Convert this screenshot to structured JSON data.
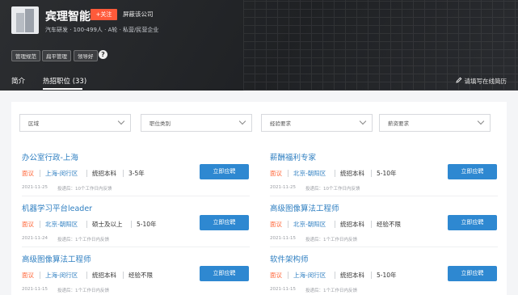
{
  "company": {
    "name": "宾理智能",
    "follow_label": "+关注",
    "blocked_label": "屏蔽该公司",
    "meta": "汽车研发 · 100-499人 · A轮 · 私营/民营企业",
    "tags": [
      "管理规范",
      "扁平管理",
      "领导好"
    ]
  },
  "tabs": [
    {
      "label": "简介"
    },
    {
      "label": "热招职位 (33)",
      "active": true
    }
  ],
  "resume_link": "请填写在线简历",
  "filters": [
    "区域",
    "职位类别",
    "经验要求",
    "薪资要求"
  ],
  "jobs": [
    {
      "title": "办公室行政-上海",
      "salary": "面议",
      "location": "上海-闵行区",
      "education": "统招本科",
      "experience": "3-5年",
      "date": "2021-11-25",
      "feedback": "投递后：10个工作日内反馈",
      "apply_label": "立即应聘"
    },
    {
      "title": "薪酬福利专家",
      "salary": "面议",
      "location": "北京-朝阳区",
      "education": "统招本科",
      "experience": "5-10年",
      "date": "2021-11-25",
      "feedback": "投递后：10个工作日内反馈",
      "apply_label": "立即应聘"
    },
    {
      "title": "机器学习平台leader",
      "salary": "面议",
      "location": "北京-朝阳区",
      "education": "硕士及以上",
      "experience": "5-10年",
      "date": "2021-11-24",
      "feedback": "投递后：1个工作日内反馈",
      "apply_label": "立即应聘"
    },
    {
      "title": "高级图像算法工程师",
      "salary": "面议",
      "location": "北京-朝阳区",
      "education": "统招本科",
      "experience": "经验不限",
      "date": "2021-11-15",
      "feedback": "投递后：1个工作日内反馈",
      "apply_label": "立即应聘"
    },
    {
      "title": "高级图像算法工程师",
      "salary": "面议",
      "location": "上海-闵行区",
      "education": "统招本科",
      "experience": "经验不限",
      "date": "2021-11-15",
      "feedback": "投递后：1个工作日内反馈",
      "apply_label": "立即应聘"
    },
    {
      "title": "软件架构师",
      "salary": "面议",
      "location": "上海-闵行区",
      "education": "统招本科",
      "experience": "5-10年",
      "date": "2021-11-15",
      "feedback": "投递后：1个工作日内反馈",
      "apply_label": "立即应聘"
    }
  ],
  "colors": {
    "accent": "#2e88d1",
    "salary": "#ff6a3d",
    "follow": "#ff5a3a"
  }
}
